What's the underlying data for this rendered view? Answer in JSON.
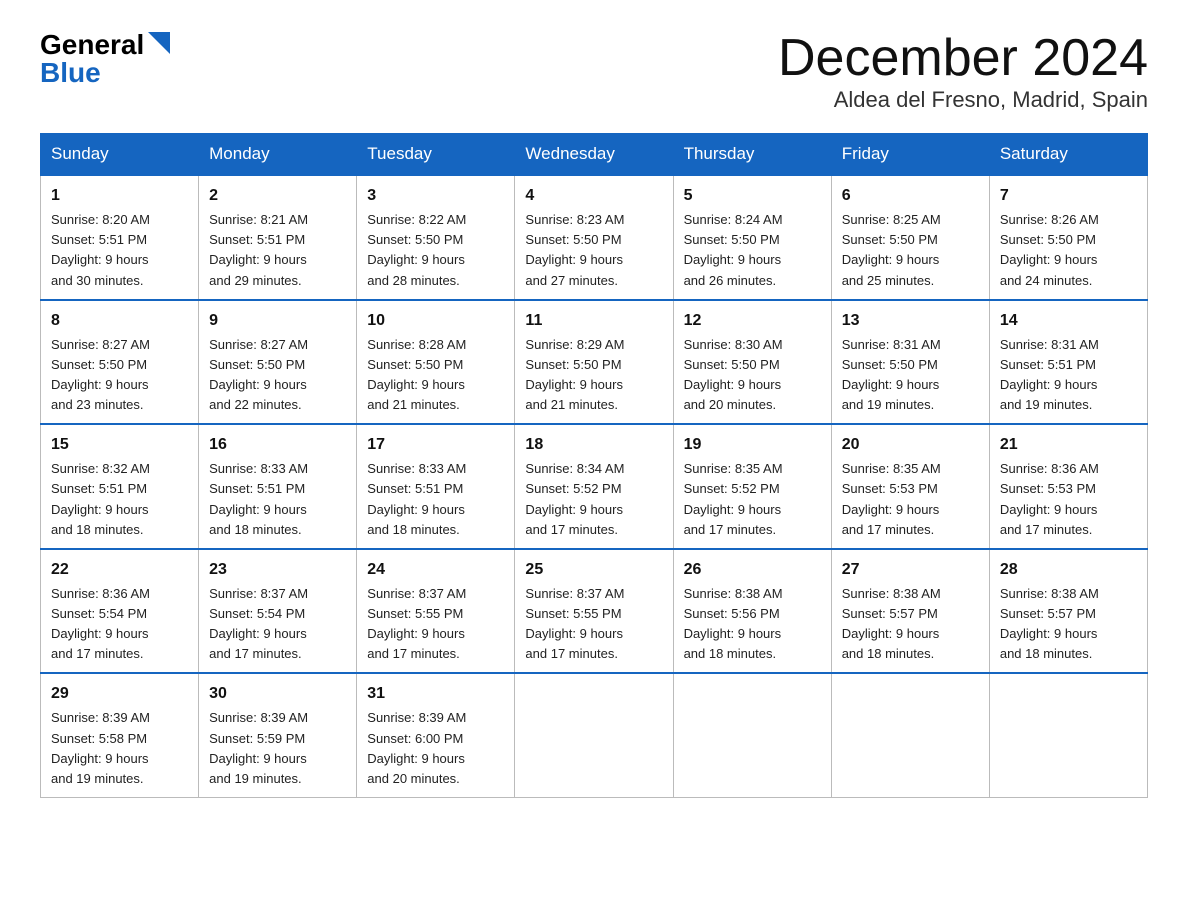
{
  "logo": {
    "general": "General",
    "blue": "Blue"
  },
  "title": {
    "month": "December 2024",
    "location": "Aldea del Fresno, Madrid, Spain"
  },
  "days_of_week": [
    "Sunday",
    "Monday",
    "Tuesday",
    "Wednesday",
    "Thursday",
    "Friday",
    "Saturday"
  ],
  "weeks": [
    [
      {
        "day": "1",
        "info": "Sunrise: 8:20 AM\nSunset: 5:51 PM\nDaylight: 9 hours\nand 30 minutes."
      },
      {
        "day": "2",
        "info": "Sunrise: 8:21 AM\nSunset: 5:51 PM\nDaylight: 9 hours\nand 29 minutes."
      },
      {
        "day": "3",
        "info": "Sunrise: 8:22 AM\nSunset: 5:50 PM\nDaylight: 9 hours\nand 28 minutes."
      },
      {
        "day": "4",
        "info": "Sunrise: 8:23 AM\nSunset: 5:50 PM\nDaylight: 9 hours\nand 27 minutes."
      },
      {
        "day": "5",
        "info": "Sunrise: 8:24 AM\nSunset: 5:50 PM\nDaylight: 9 hours\nand 26 minutes."
      },
      {
        "day": "6",
        "info": "Sunrise: 8:25 AM\nSunset: 5:50 PM\nDaylight: 9 hours\nand 25 minutes."
      },
      {
        "day": "7",
        "info": "Sunrise: 8:26 AM\nSunset: 5:50 PM\nDaylight: 9 hours\nand 24 minutes."
      }
    ],
    [
      {
        "day": "8",
        "info": "Sunrise: 8:27 AM\nSunset: 5:50 PM\nDaylight: 9 hours\nand 23 minutes."
      },
      {
        "day": "9",
        "info": "Sunrise: 8:27 AM\nSunset: 5:50 PM\nDaylight: 9 hours\nand 22 minutes."
      },
      {
        "day": "10",
        "info": "Sunrise: 8:28 AM\nSunset: 5:50 PM\nDaylight: 9 hours\nand 21 minutes."
      },
      {
        "day": "11",
        "info": "Sunrise: 8:29 AM\nSunset: 5:50 PM\nDaylight: 9 hours\nand 21 minutes."
      },
      {
        "day": "12",
        "info": "Sunrise: 8:30 AM\nSunset: 5:50 PM\nDaylight: 9 hours\nand 20 minutes."
      },
      {
        "day": "13",
        "info": "Sunrise: 8:31 AM\nSunset: 5:50 PM\nDaylight: 9 hours\nand 19 minutes."
      },
      {
        "day": "14",
        "info": "Sunrise: 8:31 AM\nSunset: 5:51 PM\nDaylight: 9 hours\nand 19 minutes."
      }
    ],
    [
      {
        "day": "15",
        "info": "Sunrise: 8:32 AM\nSunset: 5:51 PM\nDaylight: 9 hours\nand 18 minutes."
      },
      {
        "day": "16",
        "info": "Sunrise: 8:33 AM\nSunset: 5:51 PM\nDaylight: 9 hours\nand 18 minutes."
      },
      {
        "day": "17",
        "info": "Sunrise: 8:33 AM\nSunset: 5:51 PM\nDaylight: 9 hours\nand 18 minutes."
      },
      {
        "day": "18",
        "info": "Sunrise: 8:34 AM\nSunset: 5:52 PM\nDaylight: 9 hours\nand 17 minutes."
      },
      {
        "day": "19",
        "info": "Sunrise: 8:35 AM\nSunset: 5:52 PM\nDaylight: 9 hours\nand 17 minutes."
      },
      {
        "day": "20",
        "info": "Sunrise: 8:35 AM\nSunset: 5:53 PM\nDaylight: 9 hours\nand 17 minutes."
      },
      {
        "day": "21",
        "info": "Sunrise: 8:36 AM\nSunset: 5:53 PM\nDaylight: 9 hours\nand 17 minutes."
      }
    ],
    [
      {
        "day": "22",
        "info": "Sunrise: 8:36 AM\nSunset: 5:54 PM\nDaylight: 9 hours\nand 17 minutes."
      },
      {
        "day": "23",
        "info": "Sunrise: 8:37 AM\nSunset: 5:54 PM\nDaylight: 9 hours\nand 17 minutes."
      },
      {
        "day": "24",
        "info": "Sunrise: 8:37 AM\nSunset: 5:55 PM\nDaylight: 9 hours\nand 17 minutes."
      },
      {
        "day": "25",
        "info": "Sunrise: 8:37 AM\nSunset: 5:55 PM\nDaylight: 9 hours\nand 17 minutes."
      },
      {
        "day": "26",
        "info": "Sunrise: 8:38 AM\nSunset: 5:56 PM\nDaylight: 9 hours\nand 18 minutes."
      },
      {
        "day": "27",
        "info": "Sunrise: 8:38 AM\nSunset: 5:57 PM\nDaylight: 9 hours\nand 18 minutes."
      },
      {
        "day": "28",
        "info": "Sunrise: 8:38 AM\nSunset: 5:57 PM\nDaylight: 9 hours\nand 18 minutes."
      }
    ],
    [
      {
        "day": "29",
        "info": "Sunrise: 8:39 AM\nSunset: 5:58 PM\nDaylight: 9 hours\nand 19 minutes."
      },
      {
        "day": "30",
        "info": "Sunrise: 8:39 AM\nSunset: 5:59 PM\nDaylight: 9 hours\nand 19 minutes."
      },
      {
        "day": "31",
        "info": "Sunrise: 8:39 AM\nSunset: 6:00 PM\nDaylight: 9 hours\nand 20 minutes."
      },
      {
        "day": "",
        "info": ""
      },
      {
        "day": "",
        "info": ""
      },
      {
        "day": "",
        "info": ""
      },
      {
        "day": "",
        "info": ""
      }
    ]
  ]
}
